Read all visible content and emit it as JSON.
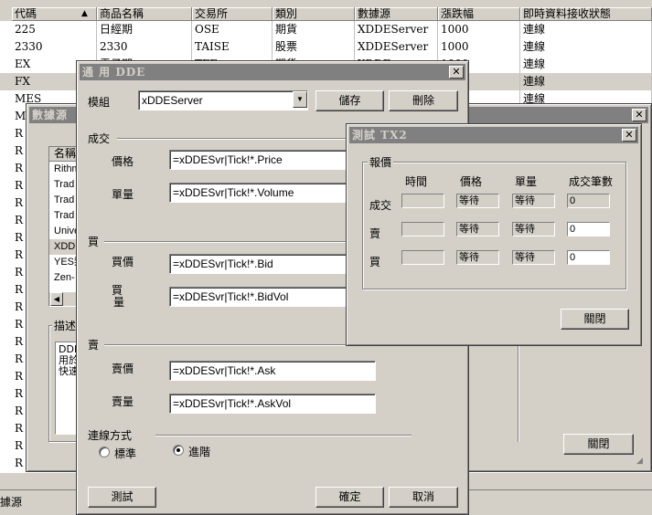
{
  "grid": {
    "columns": [
      "代碼",
      "商品名稱",
      "交易所",
      "類別",
      "數據源",
      "漲跌幅",
      "即時資料接收狀態"
    ],
    "sort_arrow": "▲",
    "rows": [
      [
        "225",
        "日經期",
        "OSE",
        "期貨",
        "XDDEServer",
        "1000",
        "連線"
      ],
      [
        "2330",
        "2330",
        "TAISE",
        "股票",
        "XDDEServer",
        "1000",
        "連線"
      ],
      [
        "EX",
        "電子期",
        "TFE",
        "期貨",
        "XDDE",
        "1000",
        "連線"
      ],
      [
        "FX",
        "",
        "",
        "",
        "",
        "",
        "連線"
      ],
      [
        "MES",
        "",
        "",
        "",
        "",
        "",
        "連線"
      ],
      [
        "M",
        "",
        "",
        "",
        "",
        "",
        ""
      ],
      [
        "R",
        "",
        "",
        "",
        "",
        "",
        ""
      ],
      [
        "R",
        "",
        "",
        "",
        "",
        "",
        ""
      ],
      [
        "R",
        "",
        "",
        "",
        "",
        "",
        ""
      ],
      [
        "R",
        "",
        "",
        "",
        "",
        "",
        ""
      ],
      [
        "R",
        "",
        "",
        "",
        "",
        "",
        ""
      ],
      [
        "R",
        "",
        "",
        "",
        "",
        "",
        ""
      ],
      [
        "R",
        "",
        "",
        "",
        "",
        "",
        ""
      ],
      [
        "R",
        "",
        "",
        "",
        "",
        "",
        ""
      ],
      [
        "R",
        "",
        "",
        "",
        "",
        "",
        ""
      ],
      [
        "R",
        "",
        "",
        "",
        "",
        "",
        ""
      ],
      [
        "R",
        "",
        "",
        "",
        "",
        "",
        ""
      ],
      [
        "R",
        "",
        "",
        "",
        "",
        "",
        ""
      ],
      [
        "R",
        "",
        "",
        "",
        "",
        "",
        ""
      ],
      [
        "R",
        "",
        "",
        "",
        "",
        "",
        ""
      ],
      [
        "R",
        "",
        "",
        "",
        "",
        "",
        ""
      ],
      [
        "R",
        "",
        "",
        "",
        "",
        "",
        ""
      ],
      [
        "R",
        "",
        "",
        "",
        "",
        "",
        ""
      ],
      [
        "R",
        "",
        "",
        "",
        "",
        "",
        ""
      ],
      [
        "R",
        "",
        "",
        "",
        "",
        "",
        ""
      ],
      [
        "R",
        "",
        "",
        "",
        "",
        "",
        ""
      ]
    ],
    "status_text": "據源"
  },
  "datasource_window": {
    "title": "數據源",
    "list_header": "名稱",
    "list_items": [
      "Rithmi",
      "Trad",
      "Trad",
      "Trad",
      "Unive",
      "XDDE",
      "YES類",
      "Zen-"
    ],
    "desc_label": "描述",
    "desc_lines": [
      "DDE",
      "用於",
      "快速"
    ],
    "close_button": "關閉"
  },
  "dde_window": {
    "title": "通 用  DDE",
    "module_label": "模組",
    "module_value": "xDDEServer",
    "save_button": "儲存",
    "delete_button": "刪除",
    "trade_section": "成交",
    "price_label": "價格",
    "price_value": "=xDDESvr|Tick!*.Price",
    "volume_label": "單量",
    "volume_value": "=xDDESvr|Tick!*.Volume",
    "buy_section": "買",
    "bid_label": "買價",
    "bid_value": "=xDDESvr|Tick!*.Bid",
    "bidvol_label_1": "買",
    "bidvol_label_2": "量",
    "bidvol_value": "=xDDESvr|Tick!*.BidVol",
    "sell_section": "賣",
    "ask_label": "賣價",
    "ask_value": "=xDDESvr|Tick!*.Ask",
    "askvol_label": "賣量",
    "askvol_value": "=xDDESvr|Tick!*.AskVol",
    "conn_section": "連線方式",
    "radio_standard": "標準",
    "radio_advanced": "進階",
    "test_button": "測試",
    "ok_button": "確定",
    "cancel_button": "取消"
  },
  "tx2_window": {
    "title": "測試  TX2",
    "group_label": "報價",
    "col_time": "時間",
    "col_price": "價格",
    "col_volume": "單量",
    "col_count": "成交筆數",
    "row_trade": "成交",
    "row_sell": "賣",
    "row_buy": "買",
    "trade_price": "等待",
    "trade_volume": "等待",
    "trade_count": "0",
    "sell_price": "等待",
    "sell_volume": "等待",
    "sell_count": "0",
    "buy_price": "等待",
    "buy_volume": "等待",
    "buy_count": "0",
    "close_button": "關閉"
  }
}
